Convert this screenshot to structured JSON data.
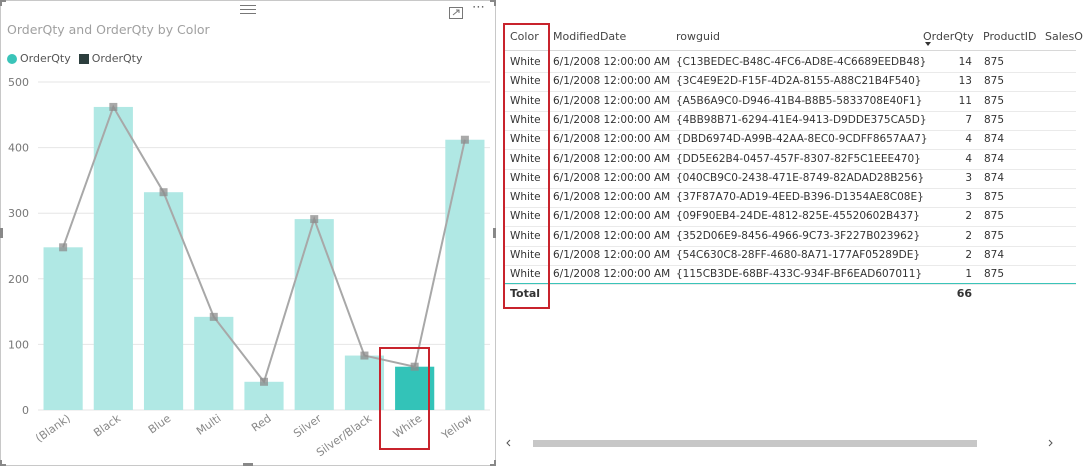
{
  "chart_panel": {
    "title": "OrderQty and OrderQty by Color",
    "legend": [
      {
        "label": "OrderQty",
        "color": "#3ac4b9",
        "marker": "circle"
      },
      {
        "label": "OrderQty",
        "color": "#2c3e3d",
        "marker": "square"
      }
    ],
    "icons": [
      "drag-grip-icon",
      "focus-mode-icon",
      "more-options-icon"
    ]
  },
  "chart_data": {
    "type": "bar",
    "title": "OrderQty and OrderQty by Color",
    "xlabel": "",
    "ylabel": "",
    "categories": [
      "(Blank)",
      "Black",
      "Blue",
      "Multi",
      "Red",
      "Silver",
      "Silver/Black",
      "White",
      "Yellow"
    ],
    "series": [
      {
        "name": "OrderQty",
        "kind": "bar",
        "color": "#b0e8e4",
        "highlight_color": "#33c3b8",
        "values": [
          248,
          462,
          332,
          142,
          43,
          291,
          83,
          66,
          412
        ]
      },
      {
        "name": "OrderQty",
        "kind": "line",
        "color": "#a8a8a8",
        "marker_color": "#8c8c8c",
        "values": [
          248,
          462,
          332,
          142,
          43,
          291,
          83,
          66,
          412
        ]
      }
    ],
    "highlighted_category": "White",
    "yticks": [
      0,
      100,
      200,
      300,
      400,
      500
    ],
    "ylim": [
      0,
      500
    ],
    "grid": true,
    "legend_position": "top-left"
  },
  "table": {
    "columns": [
      "Color",
      "ModifiedDate",
      "rowguid",
      "OrderQty",
      "ProductID",
      "SalesO"
    ],
    "sorted_column": "OrderQty",
    "rows": [
      [
        "White",
        "6/1/2008 12:00:00 AM",
        "{C13BEDEC-B48C-4FC6-AD8E-4C6689EEDB48}",
        "14",
        "875"
      ],
      [
        "White",
        "6/1/2008 12:00:00 AM",
        "{3C4E9E2D-F15F-4D2A-8155-A88C21B4F540}",
        "13",
        "875"
      ],
      [
        "White",
        "6/1/2008 12:00:00 AM",
        "{A5B6A9C0-D946-41B4-B8B5-5833708E40F1}",
        "11",
        "875"
      ],
      [
        "White",
        "6/1/2008 12:00:00 AM",
        "{4BB98B71-6294-41E4-9413-D9DDE375CA5D}",
        "7",
        "875"
      ],
      [
        "White",
        "6/1/2008 12:00:00 AM",
        "{DBD6974D-A99B-42AA-8EC0-9CDFF8657AA7}",
        "4",
        "874"
      ],
      [
        "White",
        "6/1/2008 12:00:00 AM",
        "{DD5E62B4-0457-457F-8307-82F5C1EEE470}",
        "4",
        "874"
      ],
      [
        "White",
        "6/1/2008 12:00:00 AM",
        "{040CB9C0-2438-471E-8749-82ADAD28B256}",
        "3",
        "874"
      ],
      [
        "White",
        "6/1/2008 12:00:00 AM",
        "{37F87A70-AD19-4EED-B396-D1354AE8C08E}",
        "3",
        "875"
      ],
      [
        "White",
        "6/1/2008 12:00:00 AM",
        "{09F90EB4-24DE-4812-825E-45520602B437}",
        "2",
        "875"
      ],
      [
        "White",
        "6/1/2008 12:00:00 AM",
        "{352D06E9-8456-4966-9C73-3F227B023962}",
        "2",
        "875"
      ],
      [
        "White",
        "6/1/2008 12:00:00 AM",
        "{54C630C8-28FF-4680-8A71-177AF05289DE}",
        "2",
        "874"
      ],
      [
        "White",
        "6/1/2008 12:00:00 AM",
        "{115CB3DE-68BF-433C-934F-BF6EAD607011}",
        "1",
        "875"
      ]
    ],
    "total_label": "Total",
    "total_orderqty": "66"
  },
  "colors": {
    "accent": "#3ac4b9",
    "highlight_box": "#c8232c"
  }
}
